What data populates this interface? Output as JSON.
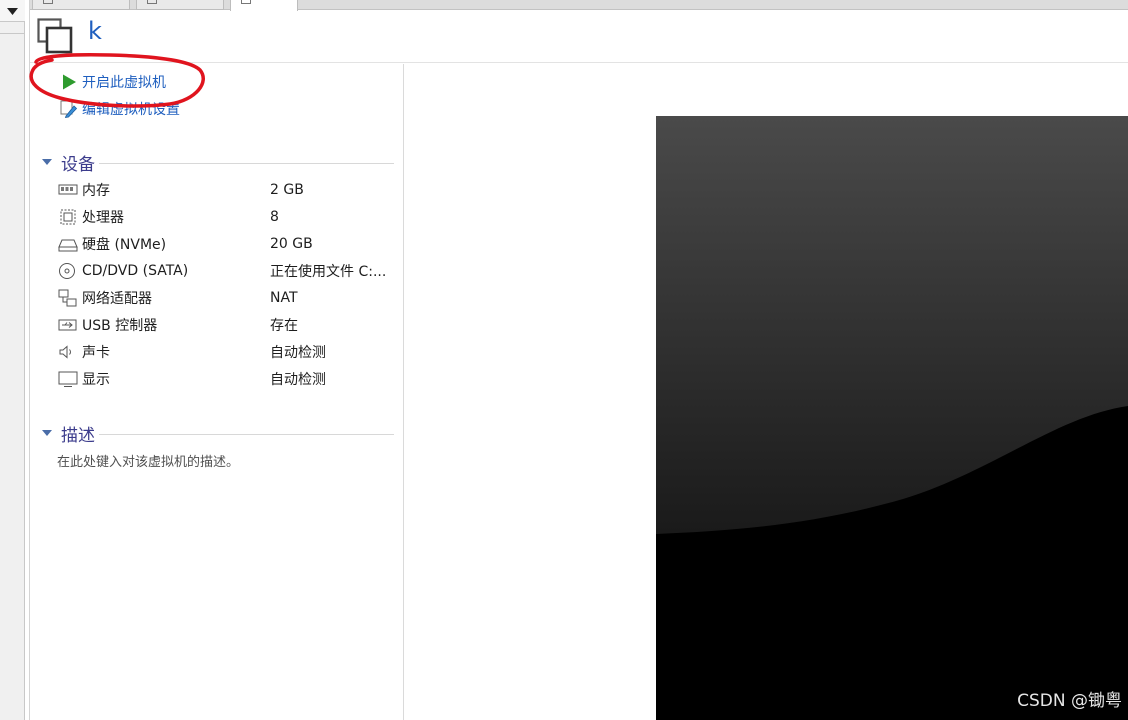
{
  "vm": {
    "title": "k"
  },
  "actions": {
    "power_on": "开启此虚拟机",
    "edit_settings": "编辑虚拟机设置"
  },
  "devices_section": {
    "title": "设备",
    "rows": [
      {
        "icon": "memory-icon",
        "name": "内存",
        "value": "2 GB"
      },
      {
        "icon": "processor-icon",
        "name": "处理器",
        "value": "8"
      },
      {
        "icon": "hard-disk-icon",
        "name": "硬盘 (NVMe)",
        "value": "20 GB"
      },
      {
        "icon": "cd-dvd-icon",
        "name": "CD/DVD (SATA)",
        "value": "正在使用文件 C:..."
      },
      {
        "icon": "network-adapter-icon",
        "name": "网络适配器",
        "value": "NAT"
      },
      {
        "icon": "usb-icon",
        "name": "USB 控制器",
        "value": "存在"
      },
      {
        "icon": "sound-card-icon",
        "name": "声卡",
        "value": "自动检测"
      },
      {
        "icon": "display-icon",
        "name": "显示",
        "value": "自动检测"
      }
    ]
  },
  "description_section": {
    "title": "描述",
    "placeholder": "在此处键入对该虚拟机的描述。"
  },
  "watermark": "CSDN @锄粤",
  "colors": {
    "link": "#1f5fbf",
    "section_title": "#3c3c8c",
    "annotation": "#e0141e",
    "play": "#2e9b2e"
  }
}
